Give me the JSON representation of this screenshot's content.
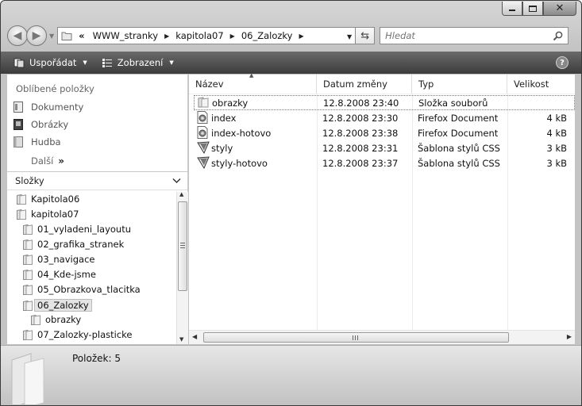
{
  "window": {
    "caption_buttons": [
      "minimize",
      "maximize",
      "close"
    ]
  },
  "address_bar": {
    "overflow_label": "«",
    "breadcrumbs": [
      "WWW_stranky",
      "kapitola07",
      "06_Zalozky"
    ]
  },
  "search": {
    "placeholder": "Hledat"
  },
  "toolbar": {
    "organize_label": "Uspořádat",
    "views_label": "Zobrazení"
  },
  "favorites": {
    "title": "Oblíbené položky",
    "items": [
      {
        "label": "Dokumenty",
        "icon": "documents-icon"
      },
      {
        "label": "Obrázky",
        "icon": "pictures-icon"
      },
      {
        "label": "Hudba",
        "icon": "music-folder-icon"
      }
    ],
    "more_label": "Další"
  },
  "folders": {
    "title": "Složky",
    "tree": [
      {
        "label": "Kapitola06",
        "level": 0
      },
      {
        "label": "kapitola07",
        "level": 0
      },
      {
        "label": "01_vyladeni_layoutu",
        "level": 1
      },
      {
        "label": "02_grafika_stranek",
        "level": 1
      },
      {
        "label": "03_navigace",
        "level": 1
      },
      {
        "label": "04_Kde-jsme",
        "level": 1
      },
      {
        "label": "05_Obrazkova_tlacitka",
        "level": 1
      },
      {
        "label": "06_Zalozky",
        "level": 1,
        "selected": true
      },
      {
        "label": "obrazky",
        "level": 2
      },
      {
        "label": "07_Zalozky-plasticke",
        "level": 1
      }
    ]
  },
  "filelist": {
    "columns": [
      "Název",
      "Datum změny",
      "Typ",
      "Velikost"
    ],
    "sort_column": "Název",
    "rows": [
      {
        "name": "obrazky",
        "date": "12.8.2008 23:40",
        "type": "Složka souborů",
        "size": "",
        "icon": "folder-icon"
      },
      {
        "name": "index",
        "date": "12.8.2008 23:30",
        "type": "Firefox Document",
        "size": "4 kB",
        "icon": "firefox-document-icon"
      },
      {
        "name": "index-hotovo",
        "date": "12.8.2008 23:38",
        "type": "Firefox Document",
        "size": "4 kB",
        "icon": "firefox-document-icon"
      },
      {
        "name": "styly",
        "date": "12.8.2008 23:31",
        "type": "Šablona stylů CSS",
        "size": "3 kB",
        "icon": "css-stylesheet-icon"
      },
      {
        "name": "styly-hotovo",
        "date": "12.8.2008 23:37",
        "type": "Šablona stylů CSS",
        "size": "3 kB",
        "icon": "css-stylesheet-icon"
      }
    ]
  },
  "details": {
    "count_label": "Položek: 5"
  }
}
